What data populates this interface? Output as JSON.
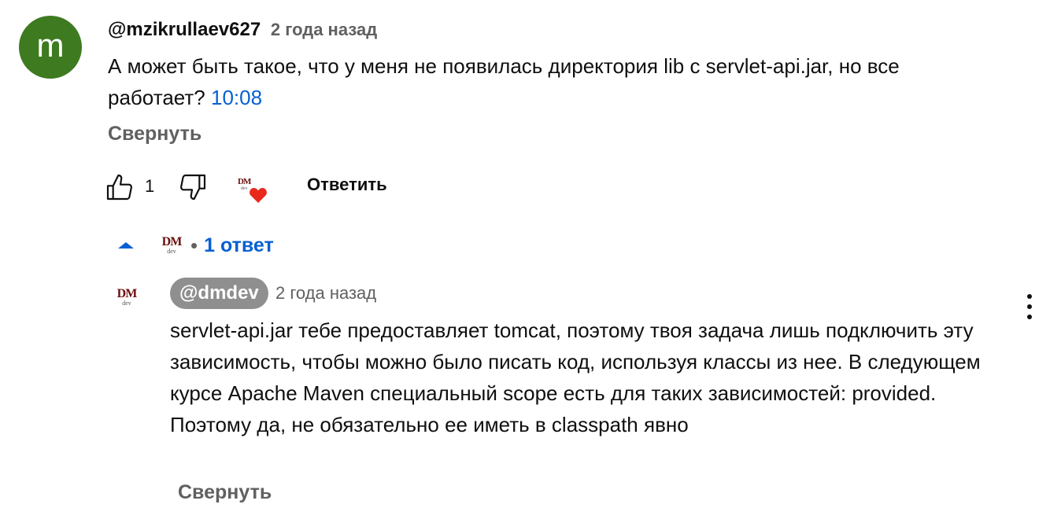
{
  "comment": {
    "avatar_letter": "m",
    "author": "@mzikrullaev627",
    "time": "2 года назад",
    "text": "А может быть такое, что у меня не появилась директория lib с servlet-api.jar, но все работает?",
    "timestamp_link": "10:08",
    "collapse_label": "Свернуть",
    "like_count": "1",
    "reply_label": "Ответить"
  },
  "replies_toggle": {
    "bullet": "•",
    "label": "1 ответ"
  },
  "reply": {
    "logo_main": "DM",
    "logo_sub": "dev",
    "author": "@dmdev",
    "time": "2 года назад",
    "text_line1": "servlet-api.jar тебе предоставляет tomcat, поэтому твоя задача лишь подключить эту зависимость, чтобы можно было писать код, используя классы из нее. В следующем курсе Apache Maven специальный scope есть для таких зависимостей: provided.",
    "text_line2": "Поэтому да, не обязательно ее иметь в classpath явно",
    "collapse_label": "Свернуть"
  },
  "colors": {
    "avatar_bg": "#3e7a1f",
    "link": "#065fd4",
    "heart": "#e8291c",
    "chip_bg": "#8f8f8f"
  },
  "icons": [
    "thumbs-up-icon",
    "thumbs-down-icon",
    "creator-heart-icon",
    "caret-up-icon",
    "more-vert-icon"
  ]
}
